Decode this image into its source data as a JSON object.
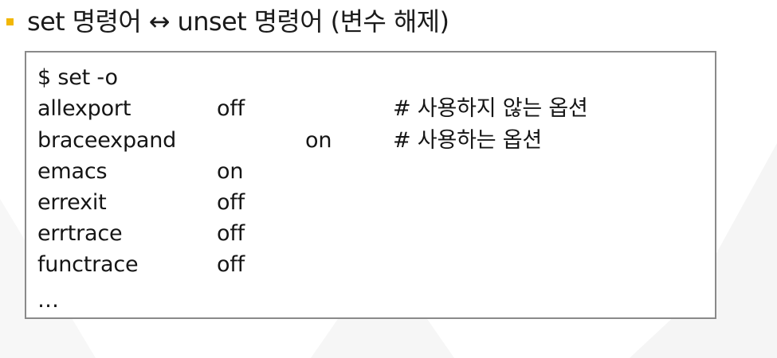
{
  "slide": {
    "title": "set 명령어 ↔ unset 명령어 (변수 해제)",
    "accent_color": "#F2B705"
  },
  "terminal": {
    "command": "$ set -o",
    "rows": [
      {
        "name": "allexport",
        "value": "off",
        "comment": "# 사용하지 않는 옵션"
      },
      {
        "name": "braceexpand",
        "value": "on",
        "comment": "# 사용하는 옵션"
      },
      {
        "name": "emacs",
        "value": "on",
        "comment": ""
      },
      {
        "name": "errexit",
        "value": "off",
        "comment": ""
      },
      {
        "name": "errtrace",
        "value": "off",
        "comment": ""
      },
      {
        "name": "functrace",
        "value": "off",
        "comment": ""
      }
    ],
    "ellipsis": "…"
  }
}
